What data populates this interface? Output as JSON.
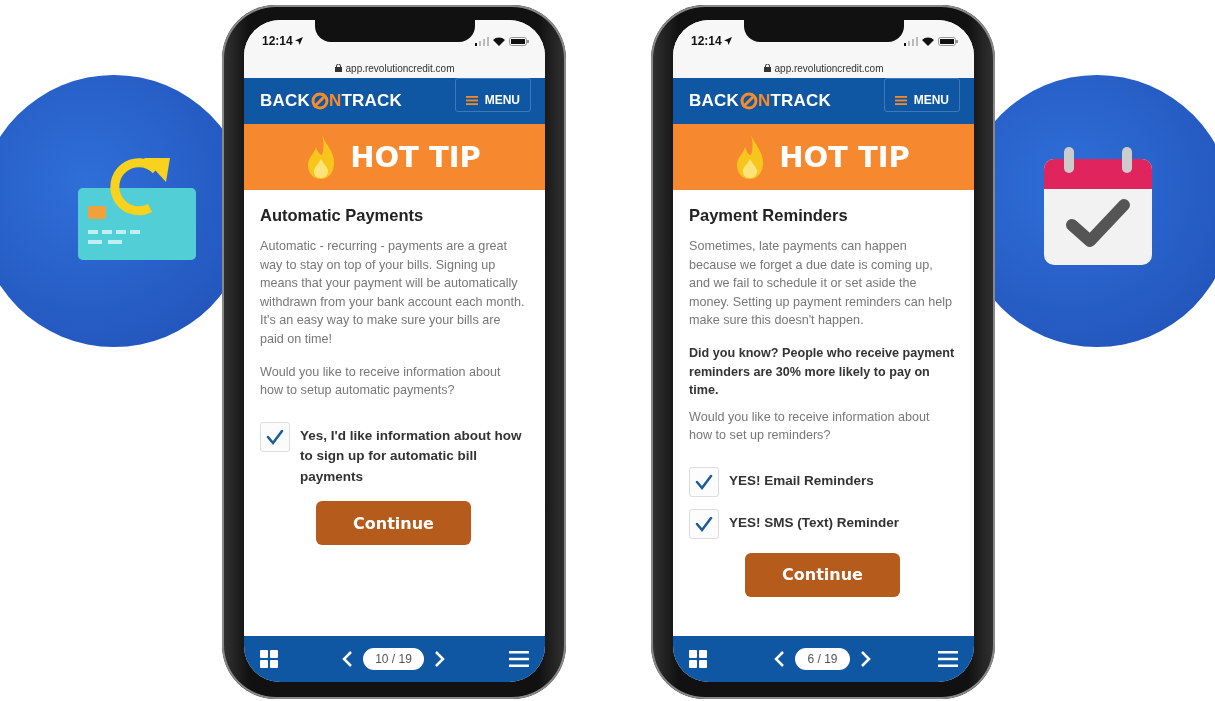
{
  "phones": [
    {
      "status_time": "12:14",
      "url": "app.revolutioncredit.com",
      "logo": {
        "start": "BACK",
        "accent": "N",
        "end": "TRACK"
      },
      "menu_label": "MENU",
      "banner": "HOT TIP",
      "title": "Automatic Payments",
      "paragraphs": [
        {
          "kind": "normal",
          "text": "Automatic - recurring - payments are a great way to stay on top of your bills. Signing up means that your payment will be automatically withdrawn from your bank account each month. It's an easy way to make sure your bills are paid on time!"
        },
        {
          "kind": "normal",
          "text": "Would you like to receive information about how to setup automatic payments?"
        }
      ],
      "options": [
        {
          "label": "Yes, I'd like information about how to sign up for automatic bill payments",
          "checked": true
        }
      ],
      "button": "Continue",
      "page": "10 / 19"
    },
    {
      "status_time": "12:14",
      "url": "app.revolutioncredit.com",
      "logo": {
        "start": "BACK",
        "accent": "N",
        "end": "TRACK"
      },
      "menu_label": "MENU",
      "banner": "HOT TIP",
      "title": "Payment Reminders",
      "paragraphs": [
        {
          "kind": "normal",
          "text": "Sometimes, late payments can happen because we forget a due date is coming up, and we fail to schedule it or set aside the money. Setting up payment reminders can help make sure this doesn't happen."
        },
        {
          "kind": "bold",
          "text": "Did you know? People who receive payment reminders are 30% more likely to pay on time."
        },
        {
          "kind": "normal",
          "text": "Would you like to receive information about how to set up reminders?"
        }
      ],
      "options": [
        {
          "label": "YES! Email Reminders",
          "checked": true
        },
        {
          "label": "YES! SMS (Text) Reminder",
          "checked": true
        }
      ],
      "button": "Continue",
      "page": "6 / 19"
    }
  ]
}
